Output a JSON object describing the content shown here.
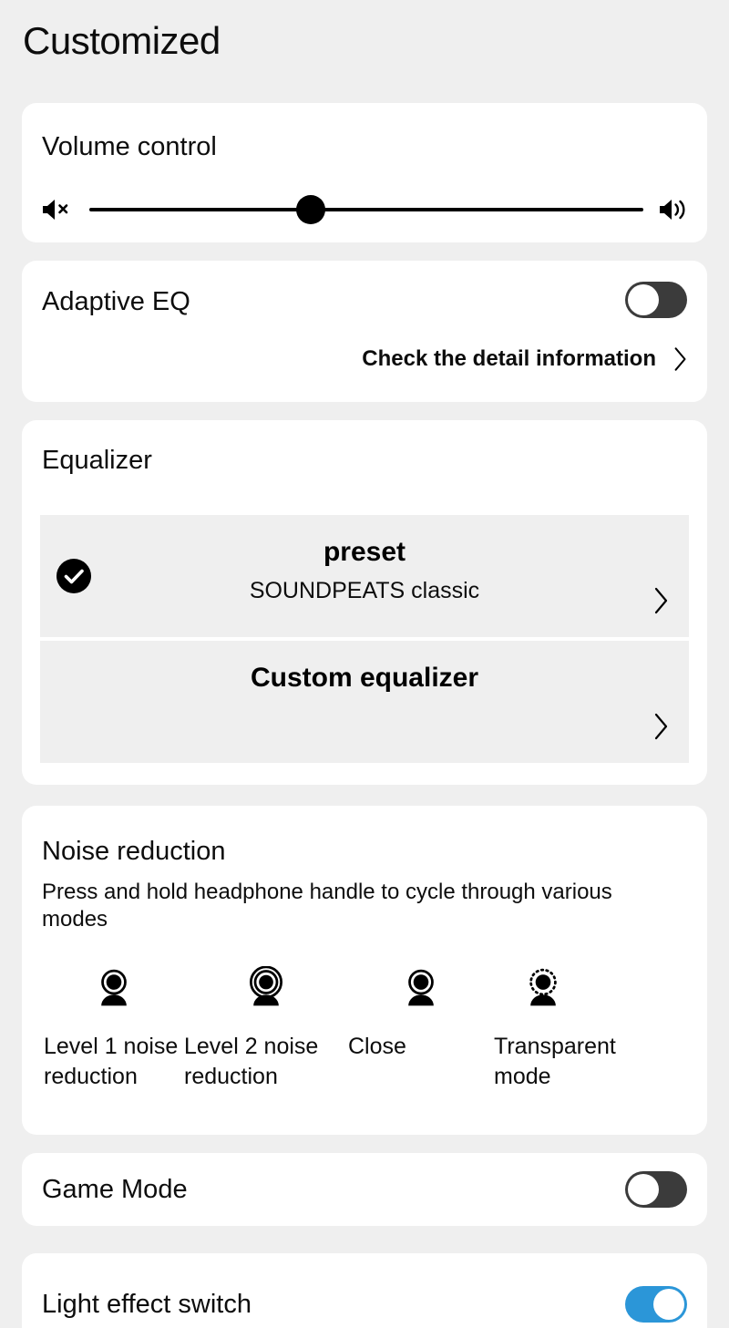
{
  "header": {
    "title": "Customized"
  },
  "volume": {
    "title": "Volume control",
    "mute_icon": "volume-mute-icon",
    "max_icon": "volume-max-icon",
    "value_percent": 40
  },
  "adaptive_eq": {
    "title": "Adaptive EQ",
    "toggle_state": "off",
    "detail_link": "Check the detail information",
    "chevron_icon": "chevron-right-icon"
  },
  "equalizer": {
    "title": "Equalizer",
    "rows": [
      {
        "id": "preset",
        "title": "preset",
        "subtitle": "SOUNDPEATS classic",
        "selected": true,
        "check_icon": "check-circle-icon",
        "chevron_icon": "chevron-right-icon"
      },
      {
        "id": "custom",
        "title": "Custom equalizer",
        "subtitle": "",
        "selected": false,
        "chevron_icon": "chevron-right-icon"
      }
    ]
  },
  "noise_reduction": {
    "title": "Noise reduction",
    "description": "Press and hold headphone handle to cycle through various modes",
    "modes": [
      {
        "label": "Level 1 noise reduction",
        "icon": "person-single-ring-icon"
      },
      {
        "label": "Level 2 noise reduction",
        "icon": "person-double-ring-icon"
      },
      {
        "label": "Close",
        "icon": "person-single-ring-icon"
      },
      {
        "label": "Transparent mode",
        "icon": "person-dotted-ring-icon"
      }
    ]
  },
  "game_mode": {
    "label": "Game Mode",
    "toggle_state": "off"
  },
  "light_effect": {
    "label": "Light effect switch",
    "toggle_state": "on"
  },
  "colors": {
    "background": "#efefef",
    "card": "#ffffff",
    "accent_on": "#2b96d8",
    "toggle_off": "#3b3b3b",
    "text": "#0d0d0d",
    "row_fill": "#efefef"
  }
}
